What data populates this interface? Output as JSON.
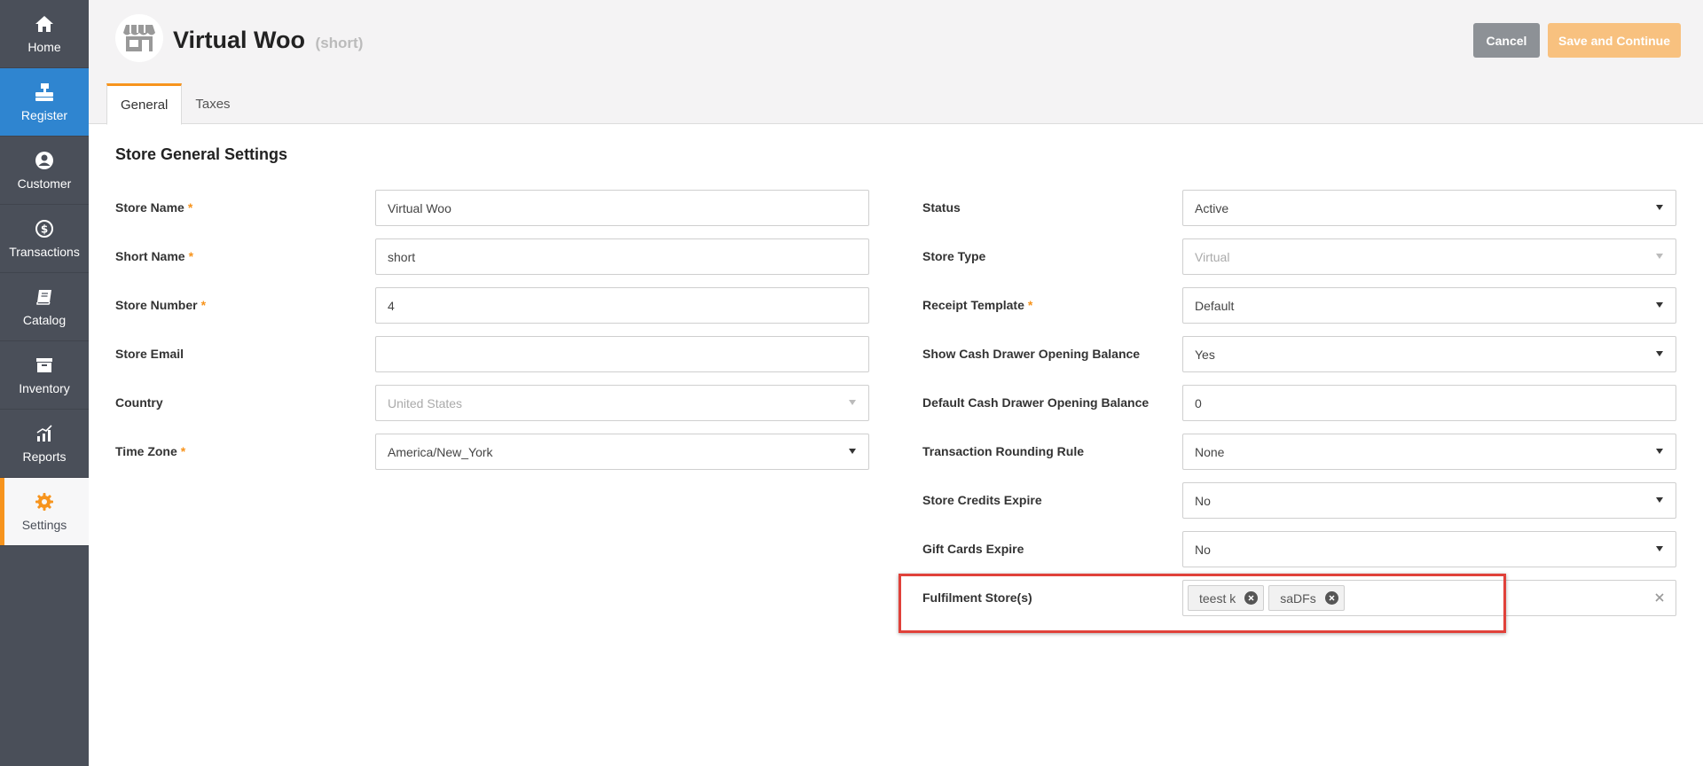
{
  "sidebar": {
    "items": [
      {
        "label": "Home",
        "icon": "home-icon"
      },
      {
        "label": "Register",
        "icon": "register-icon"
      },
      {
        "label": "Customer",
        "icon": "customer-icon"
      },
      {
        "label": "Transactions",
        "icon": "transactions-icon"
      },
      {
        "label": "Catalog",
        "icon": "catalog-icon"
      },
      {
        "label": "Inventory",
        "icon": "inventory-icon"
      },
      {
        "label": "Reports",
        "icon": "reports-icon"
      },
      {
        "label": "Settings",
        "icon": "settings-icon"
      }
    ]
  },
  "header": {
    "title": "Virtual Woo",
    "subtitle": "(short)",
    "cancel_label": "Cancel",
    "save_label": "Save and Continue"
  },
  "tabs": [
    {
      "label": "General",
      "active": true
    },
    {
      "label": "Taxes",
      "active": false
    }
  ],
  "section_title": "Store General Settings",
  "left_fields": {
    "store_name": {
      "label": "Store Name",
      "value": "Virtual Woo",
      "required": "*"
    },
    "short_name": {
      "label": "Short Name",
      "value": "short",
      "required": "*"
    },
    "store_number": {
      "label": "Store Number",
      "value": "4",
      "required": "*"
    },
    "store_email": {
      "label": "Store Email",
      "value": ""
    },
    "country": {
      "label": "Country",
      "value": "United States"
    },
    "time_zone": {
      "label": "Time Zone",
      "value": "America/New_York",
      "required": "*"
    }
  },
  "right_fields": {
    "status": {
      "label": "Status",
      "value": "Active"
    },
    "store_type": {
      "label": "Store Type",
      "value": "Virtual"
    },
    "receipt_template": {
      "label": "Receipt Template",
      "value": "Default",
      "required": "*"
    },
    "show_cash_drawer": {
      "label": "Show Cash Drawer Opening Balance",
      "value": "Yes"
    },
    "default_cash_drawer": {
      "label": "Default Cash Drawer Opening Balance",
      "value": "0"
    },
    "rounding_rule": {
      "label": "Transaction Rounding Rule",
      "value": "None"
    },
    "store_credits_expire": {
      "label": "Store Credits Expire",
      "value": "No"
    },
    "gift_cards_expire": {
      "label": "Gift Cards Expire",
      "value": "No"
    },
    "fulfilment_stores": {
      "label": "Fulfilment Store(s)",
      "tags": [
        "teest k",
        "saDFs"
      ]
    }
  },
  "colors": {
    "sidebar_bg": "#4a4f59",
    "register_active": "#2f85d0",
    "accent_orange": "#f7941d",
    "highlight_red": "#e0413a"
  }
}
